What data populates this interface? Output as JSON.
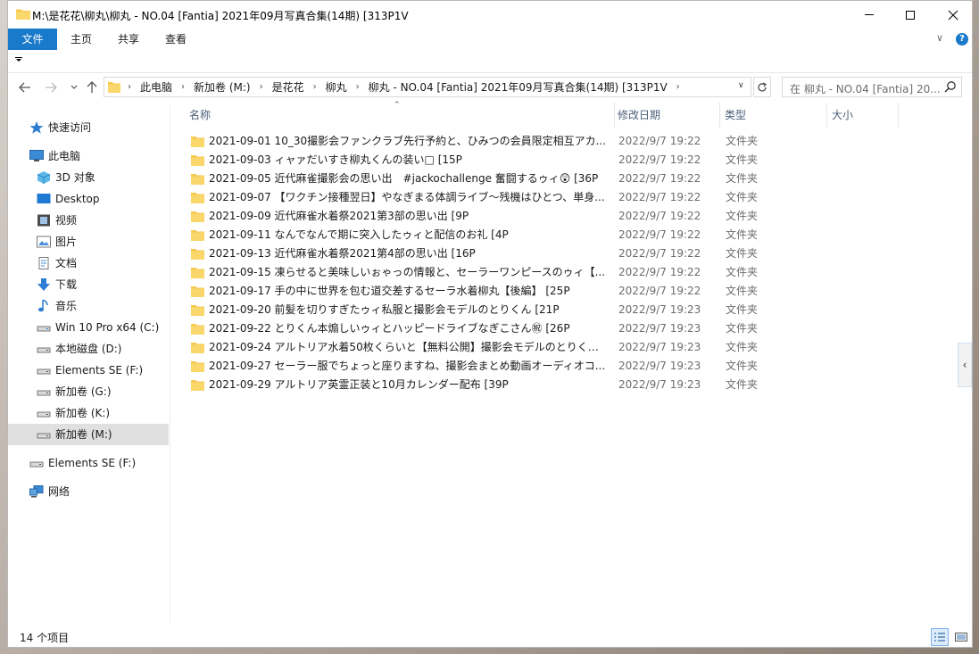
{
  "window": {
    "title": "M:\\是花花\\柳丸\\柳丸 - NO.04 [Fantia] 2021年09月写真合集(14期) [313P1V"
  },
  "ribbon": {
    "tabs": [
      "文件",
      "主页",
      "共享",
      "查看"
    ],
    "accent": "#1979ca",
    "help": "?"
  },
  "address": {
    "crumbs": [
      "此电脑",
      "新加卷 (M:)",
      "是花花",
      "柳丸",
      "柳丸 - NO.04 [Fantia] 2021年09月写真合集(14期) [313P1V"
    ]
  },
  "search": {
    "placeholder": "在 柳丸 - NO.04 [Fantia] 20..."
  },
  "sidebar": {
    "items": [
      {
        "label": "快速访问",
        "icon": "star-icon"
      },
      {
        "label": "此电脑",
        "icon": "computer-icon"
      },
      {
        "label": "3D 对象",
        "icon": "cube-icon"
      },
      {
        "label": "Desktop",
        "icon": "desktop-icon"
      },
      {
        "label": "视频",
        "icon": "video-icon"
      },
      {
        "label": "图片",
        "icon": "pictures-icon"
      },
      {
        "label": "文档",
        "icon": "document-icon"
      },
      {
        "label": "下载",
        "icon": "download-icon"
      },
      {
        "label": "音乐",
        "icon": "music-icon"
      },
      {
        "label": "Win 10 Pro x64 (C:)",
        "icon": "drive-icon"
      },
      {
        "label": "本地磁盘 (D:)",
        "icon": "drive-icon"
      },
      {
        "label": "Elements SE (F:)",
        "icon": "drive-icon"
      },
      {
        "label": "新加卷 (G:)",
        "icon": "drive-icon"
      },
      {
        "label": "新加卷 (K:)",
        "icon": "drive-icon"
      },
      {
        "label": "新加卷 (M:)",
        "icon": "drive-icon",
        "selected": true
      },
      {
        "label": "Elements SE (F:)",
        "icon": "drive-icon"
      },
      {
        "label": "网络",
        "icon": "network-icon"
      }
    ]
  },
  "columns": {
    "name": "名称",
    "date": "修改日期",
    "type": "类型",
    "size": "大小"
  },
  "files": [
    {
      "name": "2021-09-01 10_30撮影会ファンクラブ先行予約と、ひみつの会員限定相互アカ...",
      "date": "2022/9/7 19:22",
      "type": "文件夹"
    },
    {
      "name": "2021-09-03 ィャァだいすき柳丸くんの装い□ [15P",
      "date": "2022/9/7 19:22",
      "type": "文件夹"
    },
    {
      "name": "2021-09-05 近代麻雀撮影会の思い出　#jackochallenge 奮闘するゥィ😲 [36P",
      "date": "2022/9/7 19:22",
      "type": "文件夹"
    },
    {
      "name": "2021-09-07 【ワクチン接種翌日】やなぎまる体調ライブ～残機はひとつ、単身...",
      "date": "2022/9/7 19:22",
      "type": "文件夹"
    },
    {
      "name": "2021-09-09 近代麻雀水着祭2021第3部の思い出 [9P",
      "date": "2022/9/7 19:22",
      "type": "文件夹"
    },
    {
      "name": "2021-09-11 なんでなんで期に突入したゥィと配信のお礼 [4P",
      "date": "2022/9/7 19:22",
      "type": "文件夹"
    },
    {
      "name": "2021-09-13 近代麻雀水着祭2021第4部の思い出 [16P",
      "date": "2022/9/7 19:22",
      "type": "文件夹"
    },
    {
      "name": "2021-09-15 凍らせると美味しいぉゃっの情報と、セーラーワンピースのゥィ【...",
      "date": "2022/9/7 19:22",
      "type": "文件夹"
    },
    {
      "name": "2021-09-17 手の中に世界を包む道交差するセーラ水着柳丸【後編】 [25P",
      "date": "2022/9/7 19:22",
      "type": "文件夹"
    },
    {
      "name": "2021-09-20 前髪を切りすぎたゥィ私服と撮影会モデルのとりくん [21P",
      "date": "2022/9/7 19:23",
      "type": "文件夹"
    },
    {
      "name": "2021-09-22 とりくん本煽しいゥィとハッピードライブなぎこさん㊗ [26P",
      "date": "2022/9/7 19:23",
      "type": "文件夹"
    },
    {
      "name": "2021-09-24 アルトリア水着50枚くらいと【無料公開】撮影会モデルのとりくん ...",
      "date": "2022/9/7 19:23",
      "type": "文件夹"
    },
    {
      "name": "2021-09-27 セーラー服でちょっと座りますね、撮影会まとめ動画オーディオコ...",
      "date": "2022/9/7 19:23",
      "type": "文件夹"
    },
    {
      "name": "2021-09-29 アルトリア英霊正装と10月カレンダー配布 [39P",
      "date": "2022/9/7 19:23",
      "type": "文件夹"
    }
  ],
  "status": {
    "count": "14 个项目"
  },
  "colors": {
    "folder": "#f6c950",
    "selected_bg": "#e0e0e0",
    "header_text": "#4c607a"
  }
}
